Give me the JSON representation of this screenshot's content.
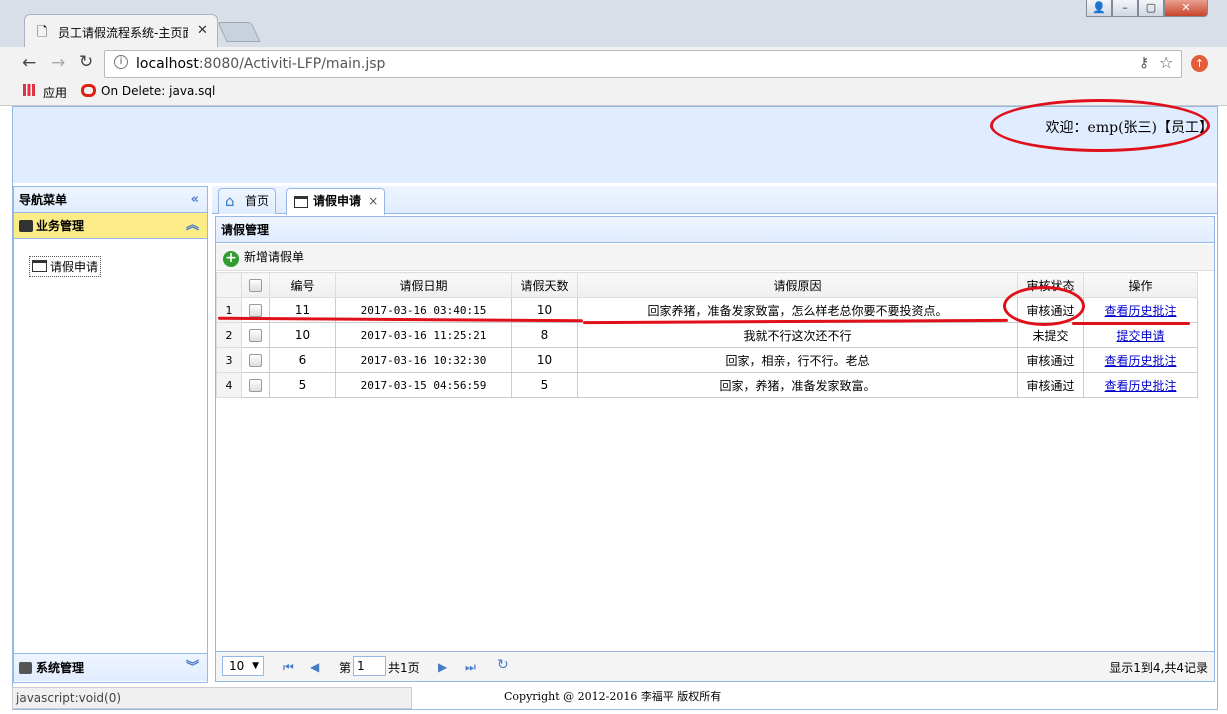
{
  "browser": {
    "tab_title": "员工请假流程系统-主页面",
    "url_host": "localhost",
    "url_rest": ":8080/Activiti-LFP/main.jsp",
    "bookmarks": [
      "应用",
      "On Delete: java.sql.S"
    ]
  },
  "header": {
    "welcome": "欢迎：emp(张三)【员工】"
  },
  "nav": {
    "title": "导航菜单",
    "sections": [
      {
        "label": "业务管理",
        "items": [
          "请假申请"
        ]
      },
      {
        "label": "系统管理"
      }
    ]
  },
  "tabs": [
    {
      "label": "首页"
    },
    {
      "label": "请假申请",
      "close": "×"
    }
  ],
  "grid": {
    "title": "请假管理",
    "toolbar_add": "新增请假单",
    "columns": [
      "编号",
      "请假日期",
      "请假天数",
      "请假原因",
      "审核状态",
      "操作"
    ],
    "rows": [
      {
        "rn": "1",
        "id": "11",
        "date": "2017-03-16 03:40:15",
        "days": "10",
        "reason": "回家养猪，准备发家致富，怎么样老总你要不要投资点。",
        "status": "审核通过",
        "action": "查看历史批注"
      },
      {
        "rn": "2",
        "id": "10",
        "date": "2017-03-16 11:25:21",
        "days": "8",
        "reason": "我就不行这次还不行",
        "status": "未提交",
        "action": "提交申请"
      },
      {
        "rn": "3",
        "id": "6",
        "date": "2017-03-16 10:32:30",
        "days": "10",
        "reason": "回家，相亲，行不行。老总",
        "status": "审核通过",
        "action": "查看历史批注"
      },
      {
        "rn": "4",
        "id": "5",
        "date": "2017-03-15 04:56:59",
        "days": "5",
        "reason": "回家，养猪，准备发家致富。",
        "status": "审核通过",
        "action": "查看历史批注"
      }
    ]
  },
  "pager": {
    "page_size": "10",
    "page_prefix": "第",
    "page_num": "1",
    "page_total": "共1页",
    "info": "显示1到4,共4记录"
  },
  "status_bar": "javascript:void(0)",
  "footer": "Copyright @ 2012-2016 李福平 版权所有",
  "colors": {
    "annotation": "#e0101a",
    "panel_border": "#95b8e7",
    "header_bg": "#e0ecff",
    "selected_accordion": "#fbec88"
  }
}
